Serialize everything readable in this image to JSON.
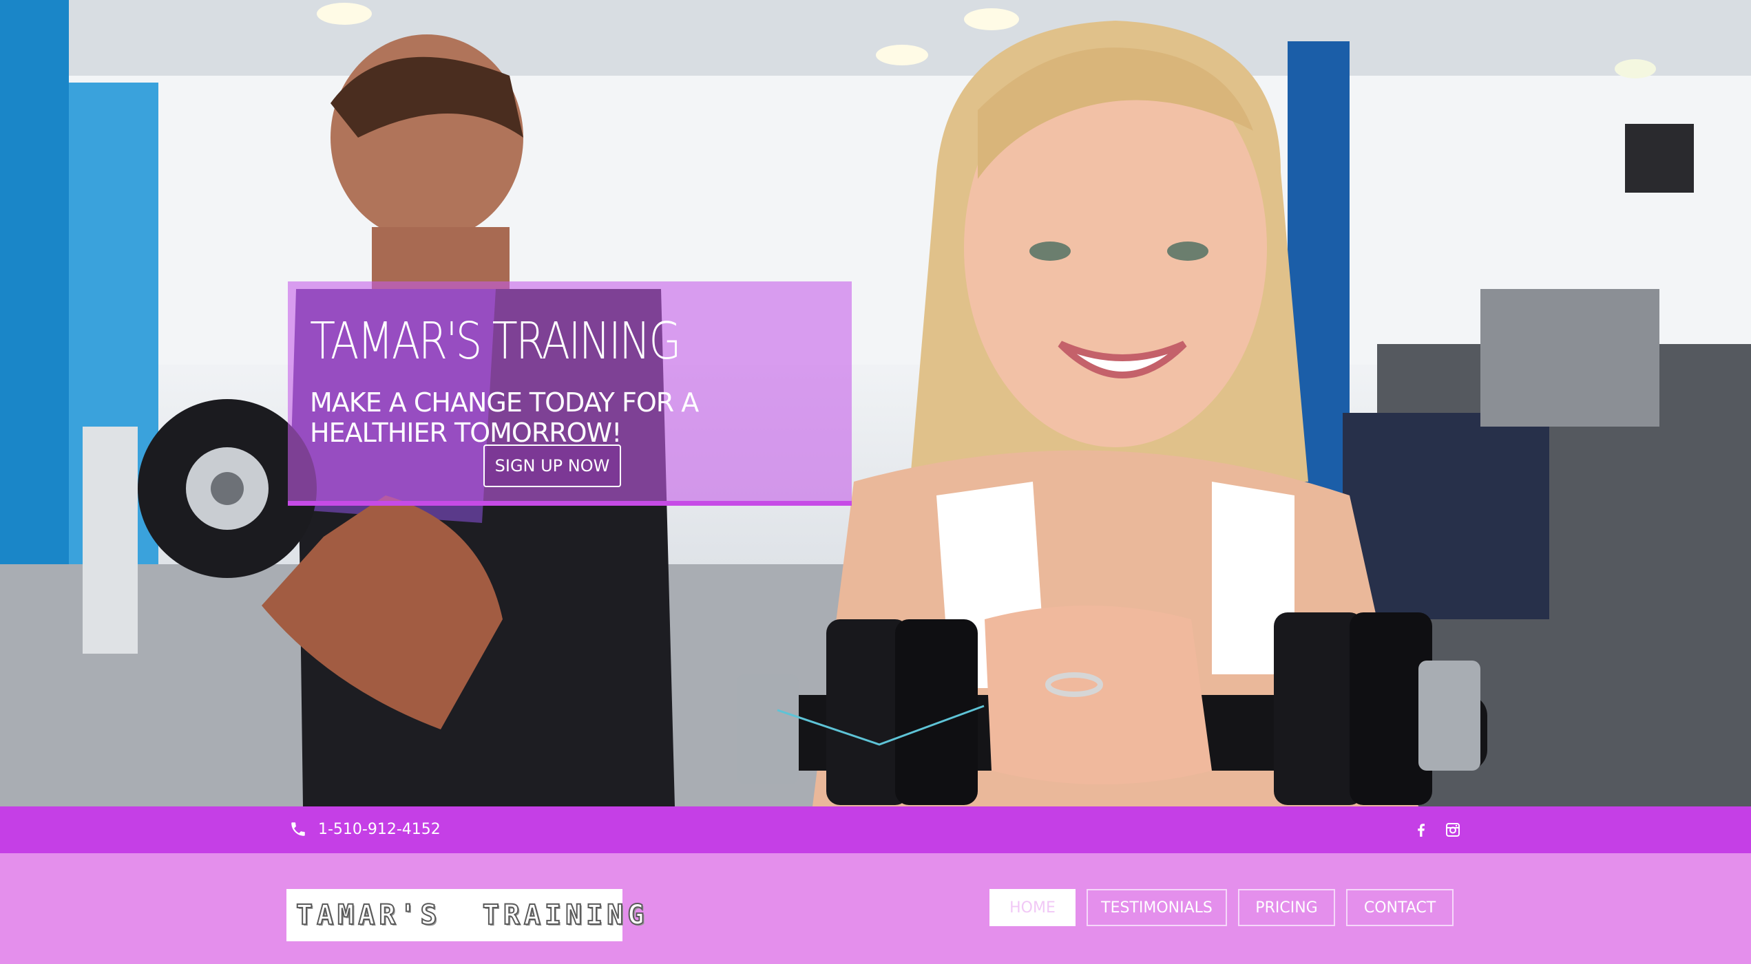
{
  "hero": {
    "title": "TAMAR'S TRAINING",
    "subtitle": "MAKE A CHANGE TODAY FOR A HEALTHIER TOMORROW!",
    "cta_label": "SIGN UP NOW"
  },
  "contact_bar": {
    "phone": "1-510-912-4152",
    "social_icons": [
      "facebook-icon",
      "instagram-icon"
    ]
  },
  "nav": {
    "logo_text": "TAMAR'S  TRAINING",
    "items": [
      {
        "label": "HOME",
        "active": true
      },
      {
        "label": "TESTIMONIALS",
        "active": false
      },
      {
        "label": "PRICING",
        "active": false
      },
      {
        "label": "CONTACT",
        "active": false
      }
    ]
  },
  "colors": {
    "card": "#c45ce8",
    "bar": "#c53fe6",
    "nav_bg": "#e48fec",
    "chevron": "#5ec3d6"
  }
}
